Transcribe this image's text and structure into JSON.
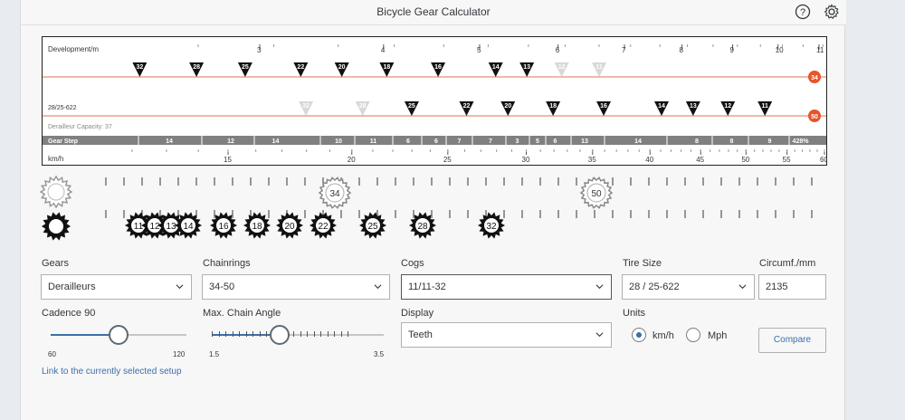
{
  "window": {
    "title": "Bicycle Gear Calculator"
  },
  "header": {
    "help_icon": "help-icon",
    "settings_icon": "gear-icon"
  },
  "chart": {
    "development_label": "Development/m",
    "development_ticks": [
      {
        "v": 3,
        "t": "3"
      },
      {
        "v": 4,
        "t": "4"
      },
      {
        "v": 5,
        "t": "5"
      },
      {
        "v": 6,
        "t": "6"
      },
      {
        "v": 7,
        "t": "7"
      },
      {
        "v": 8,
        "t": "8"
      },
      {
        "v": 9,
        "t": "9"
      },
      {
        "v": 10,
        "t": "10"
      },
      {
        "v": 11,
        "t": "11"
      }
    ],
    "chainring_row1": {
      "chainring": "34",
      "cogs": [
        {
          "cog": "32",
          "dev": 2.27,
          "on": true
        },
        {
          "cog": "28",
          "dev": 2.59,
          "on": true
        },
        {
          "cog": "25",
          "dev": 2.9,
          "on": true
        },
        {
          "cog": "22",
          "dev": 3.3,
          "on": true
        },
        {
          "cog": "20",
          "dev": 3.63,
          "on": true
        },
        {
          "cog": "18",
          "dev": 4.03,
          "on": true
        },
        {
          "cog": "16",
          "dev": 4.54,
          "on": true
        },
        {
          "cog": "14",
          "dev": 5.19,
          "on": true
        },
        {
          "cog": "13",
          "dev": 5.58,
          "on": true
        },
        {
          "cog": "12",
          "dev": 6.05,
          "on": false
        },
        {
          "cog": "11",
          "dev": 6.6,
          "on": false
        }
      ]
    },
    "chainring_row2": {
      "label": "28/25-622",
      "chainring": "50",
      "cogs": [
        {
          "cog": "32",
          "dev": 3.34,
          "on": false
        },
        {
          "cog": "28",
          "dev": 3.81,
          "on": false
        },
        {
          "cog": "25",
          "dev": 4.27,
          "on": true
        },
        {
          "cog": "22",
          "dev": 4.85,
          "on": true
        },
        {
          "cog": "20",
          "dev": 5.34,
          "on": true
        },
        {
          "cog": "18",
          "dev": 5.93,
          "on": true
        },
        {
          "cog": "16",
          "dev": 6.67,
          "on": true
        },
        {
          "cog": "14",
          "dev": 7.63,
          "on": true
        },
        {
          "cog": "13",
          "dev": 8.21,
          "on": true
        },
        {
          "cog": "12",
          "dev": 8.9,
          "on": true
        },
        {
          "cog": "11",
          "dev": 9.7,
          "on": true
        }
      ]
    },
    "derailleur_capacity": "Derailleur Capacity: 37",
    "gear_step": {
      "label": "Gear Step",
      "cells": [
        "14",
        "12",
        "14",
        "10",
        "11",
        "6",
        "6",
        "7",
        "7",
        "3",
        "5",
        "6",
        "13",
        "14",
        "8",
        "8",
        "9",
        "428%"
      ]
    },
    "speed": {
      "label": "km/h",
      "ticks": [
        {
          "v": 15,
          "t": "15"
        },
        {
          "v": 20,
          "t": "20"
        },
        {
          "v": 25,
          "t": "25"
        },
        {
          "v": 30,
          "t": "30"
        },
        {
          "v": 35,
          "t": "35"
        },
        {
          "v": 40,
          "t": "40"
        },
        {
          "v": 45,
          "t": "45"
        },
        {
          "v": 50,
          "t": "50"
        },
        {
          "v": 55,
          "t": "55"
        },
        {
          "v": 60,
          "t": "60"
        }
      ]
    }
  },
  "visual": {
    "chainrings": [
      "34",
      "50"
    ],
    "cogs": [
      "11",
      "12",
      "13",
      "14",
      "16",
      "18",
      "20",
      "22",
      "25",
      "28",
      "32"
    ]
  },
  "form": {
    "gears": {
      "label": "Gears",
      "value": "Derailleurs"
    },
    "chainrings": {
      "label": "Chainrings",
      "value": "34-50"
    },
    "cogs": {
      "label": "Cogs",
      "value": "11/11-32"
    },
    "tire_size": {
      "label": "Tire Size",
      "value": "28 / 25-622"
    },
    "circumference": {
      "label": "Circumf./mm",
      "value": "2135"
    },
    "cadence": {
      "label": "Cadence 90",
      "min": "60",
      "max": "120",
      "value": 90
    },
    "chain_angle": {
      "label": "Max. Chain Angle",
      "min": "1.5",
      "max": "3.5",
      "value": 2.5
    },
    "display": {
      "label": "Display",
      "value": "Teeth"
    },
    "units": {
      "label": "Units",
      "option1": "km/h",
      "option2": "Mph",
      "selected": "km/h"
    },
    "compare_label": "Compare",
    "link_label": "Link to the currently selected setup"
  },
  "colors": {
    "accent": "#3b6fa8",
    "chainring_line": "#e07050",
    "chainring_badge": "#e8542c",
    "gear_step_bar": "#808080"
  }
}
